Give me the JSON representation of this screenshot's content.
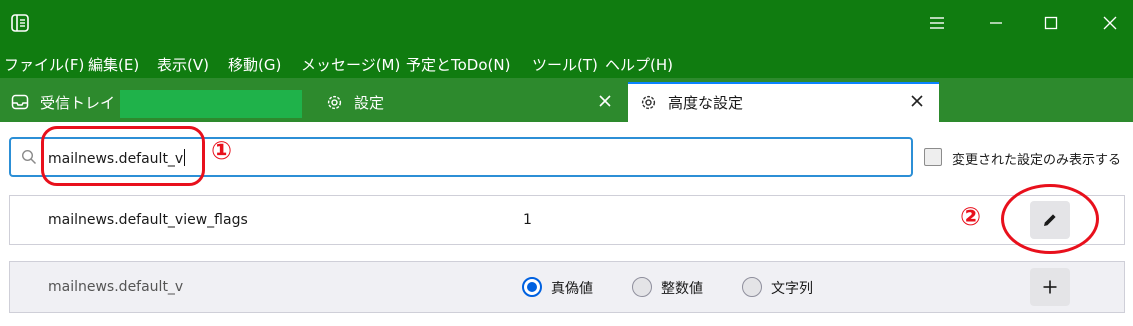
{
  "window": {
    "controls": {
      "menu": "hamburger-icon",
      "minimize": "minimize-icon",
      "maximize": "maximize-icon",
      "close": "close-icon"
    }
  },
  "menubar": {
    "items": [
      "ファイル(F)",
      "編集(E)",
      "表示(V)",
      "移動(G)",
      "メッセージ(M)",
      "予定とToDo(N)",
      "ツール(T)",
      "ヘルプ(H)"
    ]
  },
  "tabs": [
    {
      "label": "受信トレイ -",
      "icon": "inbox-icon",
      "active": false,
      "closable": false
    },
    {
      "label": "設定",
      "icon": "gear-icon",
      "active": false,
      "closable": true
    },
    {
      "label": "高度な設定",
      "icon": "gear-icon",
      "active": true,
      "closable": true
    }
  ],
  "search": {
    "value": "mailnews.default_v",
    "show_modified_label": "変更された設定のみ表示する",
    "show_modified_checked": false
  },
  "prefs": [
    {
      "name": "mailnews.default_view_flags",
      "value": "1",
      "action": "edit-icon"
    }
  ],
  "new_pref": {
    "name": "mailnews.default_v",
    "types": [
      {
        "label": "真偽値",
        "selected": true
      },
      {
        "label": "整数値",
        "selected": false
      },
      {
        "label": "文字列",
        "selected": false
      }
    ],
    "action": "plus-icon"
  },
  "annotations": {
    "marker_1": "①",
    "marker_2": "②"
  },
  "colors": {
    "titlebar": "#107c10",
    "tabbar": "#2d8a2d",
    "accent": "#0a84ff",
    "annotation": "#e8101c",
    "redaction": "#1fb24a"
  }
}
